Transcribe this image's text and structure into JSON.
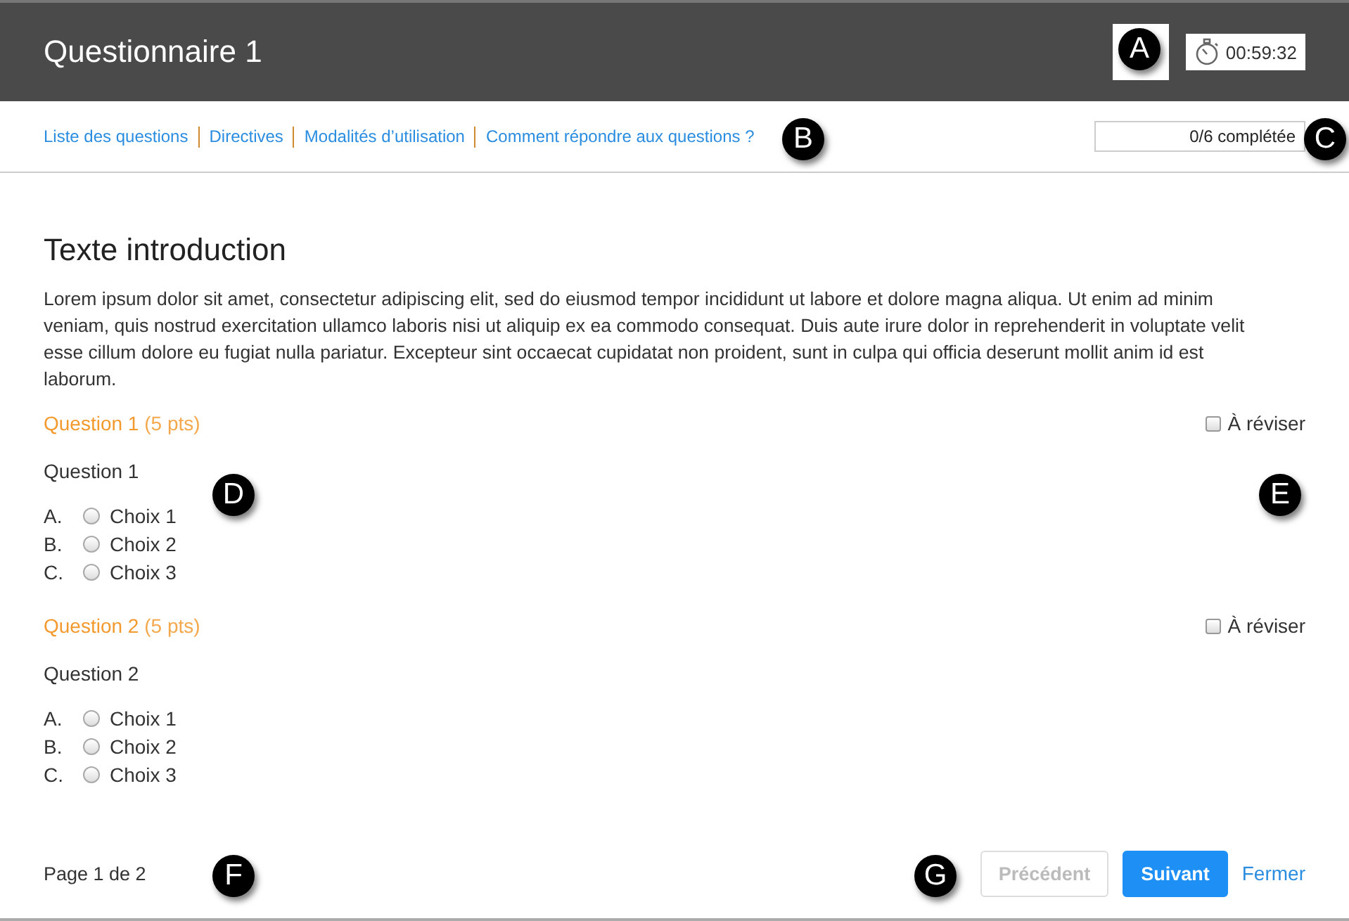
{
  "header": {
    "title": "Questionnaire 1",
    "timer": "00:59:32"
  },
  "nav": {
    "links": [
      "Liste des questions",
      "Directives",
      "Modalités d’utilisation",
      "Comment répondre aux questions ?"
    ],
    "progress": "0/6 complétée"
  },
  "intro": {
    "title": "Texte introduction",
    "text": "Lorem ipsum dolor sit amet, consectetur adipiscing elit, sed do eiusmod tempor incididunt ut labore et dolore magna aliqua. Ut enim ad minim veniam, quis nostrud exercitation ullamco laboris nisi ut aliquip ex ea commodo consequat. Duis aute irure dolor in reprehenderit in voluptate velit esse cillum dolore eu fugiat nulla pariatur. Excepteur sint occaecat cupidatat non proident, sunt in culpa qui officia deserunt mollit anim id est laborum."
  },
  "questions": [
    {
      "title": "Question 1",
      "points": "(5 pts)",
      "review_label": "À réviser",
      "review_checked": false,
      "prompt": "Question 1",
      "choices": [
        {
          "letter": "A.",
          "label": "Choix 1",
          "selected": false
        },
        {
          "letter": "B.",
          "label": "Choix 2",
          "selected": false
        },
        {
          "letter": "C.",
          "label": "Choix 3",
          "selected": false
        }
      ]
    },
    {
      "title": "Question 2",
      "points": "(5 pts)",
      "review_label": "À réviser",
      "review_checked": false,
      "prompt": "Question 2",
      "choices": [
        {
          "letter": "A.",
          "label": "Choix 1",
          "selected": false
        },
        {
          "letter": "B.",
          "label": "Choix 2",
          "selected": false
        },
        {
          "letter": "C.",
          "label": "Choix 3",
          "selected": false
        }
      ]
    }
  ],
  "footer": {
    "page": "Page 1 de 2",
    "buttons": [
      {
        "label": "Précédent",
        "kind": "secondary",
        "disabled": true
      },
      {
        "label": "Suivant",
        "kind": "primary",
        "disabled": false
      },
      {
        "label": "Fermer",
        "kind": "link",
        "disabled": false
      }
    ]
  },
  "callouts": [
    "A",
    "B",
    "C",
    "D",
    "E",
    "F",
    "G"
  ]
}
